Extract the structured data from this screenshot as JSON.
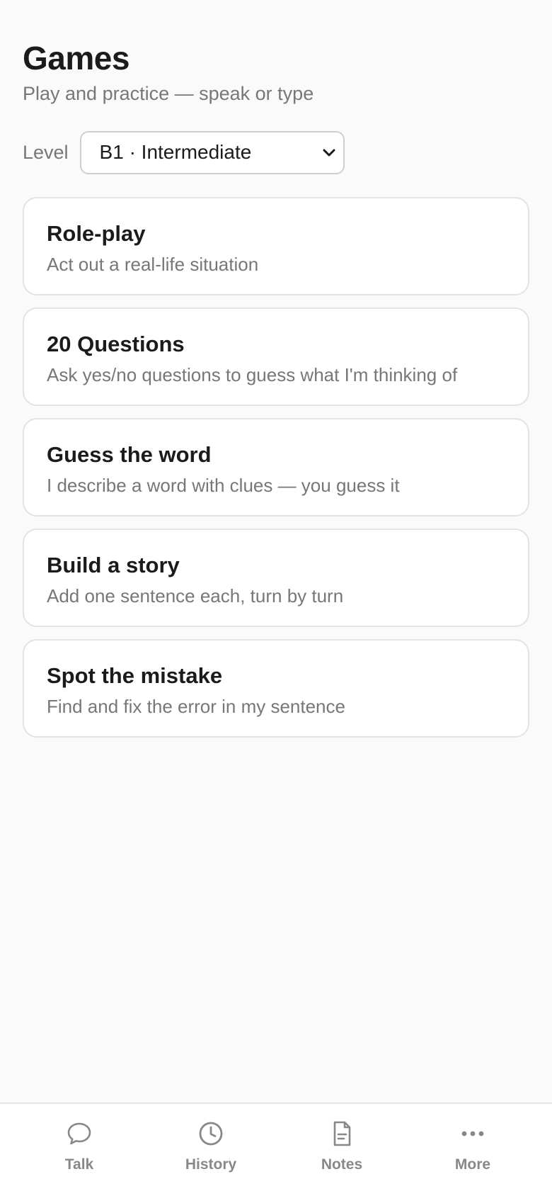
{
  "header": {
    "title": "Games",
    "subtitle": "Play and practice — speak or type"
  },
  "level": {
    "label": "Level",
    "selected": "B1 · Intermediate"
  },
  "games": [
    {
      "title": "Role-play",
      "description": "Act out a real-life situation"
    },
    {
      "title": "20 Questions",
      "description": "Ask yes/no questions to guess what I'm thinking of"
    },
    {
      "title": "Guess the word",
      "description": "I describe a word with clues — you guess it"
    },
    {
      "title": "Build a story",
      "description": "Add one sentence each, turn by turn"
    },
    {
      "title": "Spot the mistake",
      "description": "Find and fix the error in my sentence"
    }
  ],
  "tabbar": {
    "items": [
      {
        "label": "Talk",
        "icon": "chat-bubble-icon"
      },
      {
        "label": "History",
        "icon": "clock-icon"
      },
      {
        "label": "Notes",
        "icon": "document-icon"
      },
      {
        "label": "More",
        "icon": "more-dots-icon"
      }
    ],
    "icon_color": "#888888"
  },
  "colors": {
    "background": "#fafafa",
    "card_border": "#e3e3e3",
    "muted_text": "#777777"
  }
}
